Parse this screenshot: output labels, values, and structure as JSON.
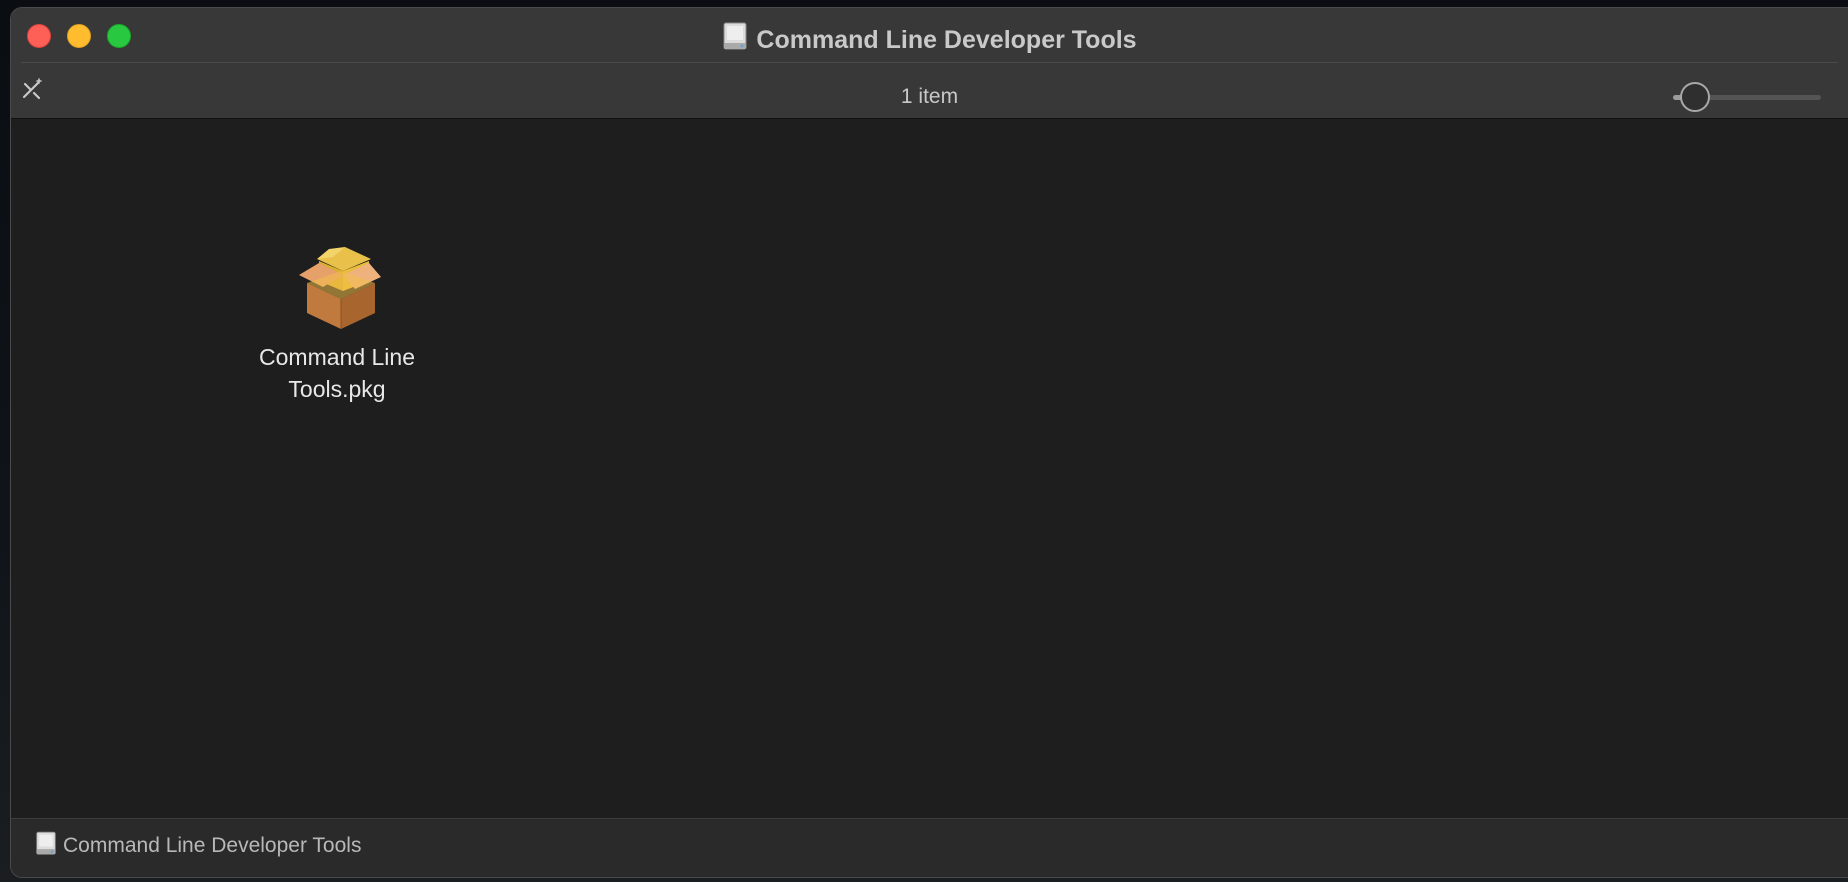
{
  "window": {
    "title": "Command Line Developer Tools",
    "title_icon": "external-disk-icon"
  },
  "toolbar": {
    "item_count": "1 item",
    "edit_icon": "edit-toolbar-icon",
    "icon_size_slider": {
      "value": 0.15
    }
  },
  "files": [
    {
      "name": "Command Line Tools.pkg",
      "name_lines": [
        "Command Line",
        "Tools.pkg"
      ],
      "icon": "package-icon"
    }
  ],
  "pathbar": {
    "label": "Command Line Developer Tools",
    "icon": "external-disk-icon"
  },
  "colors": {
    "close": "#fe5f57",
    "minimize": "#febc2e",
    "zoom": "#28c840",
    "window_bg": "#1e1e1e",
    "titlebar_bg": "#383838"
  }
}
